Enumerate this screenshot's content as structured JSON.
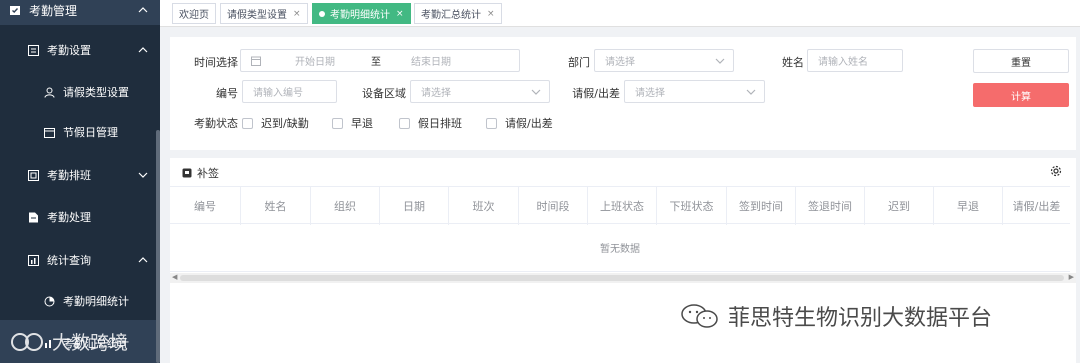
{
  "sidebar": {
    "top_item": "考勤管理",
    "settings": "考勤设置",
    "leave_type": "请假类型设置",
    "holiday": "节假日管理",
    "schedule": "考勤排班",
    "handle": "考勤处理",
    "stats": "统计查询",
    "detail_stats": "考勤明细统计",
    "summary_stats": "考勤汇总统计"
  },
  "tabs": [
    {
      "label": "欢迎页"
    },
    {
      "label": "请假类型设置",
      "close": "×"
    },
    {
      "label": "考勤明细统计",
      "close": "×"
    },
    {
      "label": "考勤汇总统计",
      "close": "×"
    }
  ],
  "form": {
    "time_label": "时间选择",
    "start_placeholder": "开始日期",
    "to_label": "至",
    "end_placeholder": "结束日期",
    "dept_label": "部门",
    "dept_placeholder": "请选择",
    "name_label": "姓名",
    "name_placeholder": "请输入姓名",
    "reset": "重置",
    "code_label": "编号",
    "code_placeholder": "请输入编号",
    "area_label": "设备区域",
    "area_placeholder": "请选择",
    "leave_label": "请假/出差",
    "leave_placeholder": "请选择",
    "calc": "计算",
    "status_label": "考勤状态",
    "status_options": [
      "迟到/缺勤",
      "早退",
      "假日排班",
      "请假/出差"
    ]
  },
  "table": {
    "toolbar_label": "补签",
    "columns": [
      "编号",
      "姓名",
      "组织",
      "日期",
      "班次",
      "时间段",
      "上班状态",
      "下班状态",
      "签到时间",
      "签退时间",
      "迟到",
      "早退",
      "请假/出差"
    ],
    "empty_text": "暂无数据"
  },
  "watermarks": {
    "main": "菲思特生物识别大数据平台",
    "secondary": "大数跨境"
  },
  "colors": {
    "sidebar_bg": "#304156",
    "active_tab": "#42b983",
    "calc_button": "#f56c6c",
    "active_menu": "#409eff"
  }
}
